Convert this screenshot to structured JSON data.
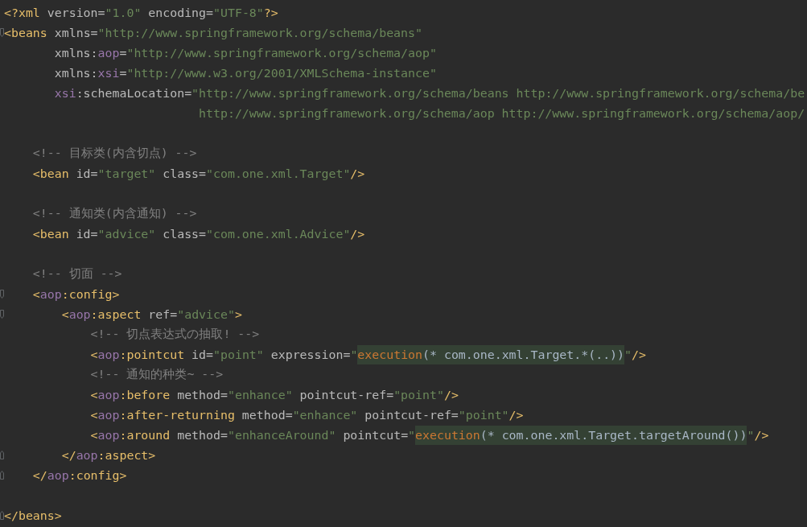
{
  "editor": {
    "lines": [
      {
        "tokens": [
          {
            "kind": "tag",
            "text": "<?xml "
          },
          {
            "kind": "attr",
            "text": "version="
          },
          {
            "kind": "value",
            "text": "\"1.0\" "
          },
          {
            "kind": "attr",
            "text": "encoding="
          },
          {
            "kind": "value",
            "text": "\"UTF-8\""
          },
          {
            "kind": "tag",
            "text": "?>"
          }
        ]
      },
      {
        "fold_start": true,
        "tokens": [
          {
            "kind": "tag",
            "text": "<beans "
          },
          {
            "kind": "attr",
            "text": "xmlns="
          },
          {
            "kind": "value",
            "text": "\"http://www.springframework.org/schema/beans\""
          }
        ]
      },
      {
        "tokens": [
          {
            "kind": "attr",
            "text": "       xmlns:"
          },
          {
            "kind": "ns",
            "text": "aop"
          },
          {
            "kind": "attr",
            "text": "="
          },
          {
            "kind": "value",
            "text": "\"http://www.springframework.org/schema/aop\""
          }
        ]
      },
      {
        "tokens": [
          {
            "kind": "attr",
            "text": "       xmlns:"
          },
          {
            "kind": "ns",
            "text": "xsi"
          },
          {
            "kind": "attr",
            "text": "="
          },
          {
            "kind": "value",
            "text": "\"http://www.w3.org/2001/XMLSchema-instance\""
          }
        ]
      },
      {
        "tokens": [
          {
            "kind": "ns",
            "text": "       xsi"
          },
          {
            "kind": "attr",
            "text": ":schemaLocation="
          },
          {
            "kind": "value",
            "text": "\"http://www.springframework.org/schema/beans http://www.springframework.org/schema/be"
          }
        ]
      },
      {
        "tokens": [
          {
            "kind": "value",
            "text": "                           http://www.springframework.org/schema/aop http://www.springframework.org/schema/aop/"
          }
        ]
      },
      {
        "space_above": true,
        "tokens": [
          {
            "kind": "comment",
            "text": "    <!-- 目标类(内含切点) -->"
          }
        ]
      },
      {
        "tokens": [
          {
            "kind": "tag",
            "text": "    <bean "
          },
          {
            "kind": "attr",
            "text": "id="
          },
          {
            "kind": "value",
            "text": "\"target\" "
          },
          {
            "kind": "attr",
            "text": "class="
          },
          {
            "kind": "value",
            "text": "\"com.one.xml.Target\""
          },
          {
            "kind": "tag",
            "text": "/>"
          }
        ]
      },
      {
        "space_above": true,
        "tokens": [
          {
            "kind": "comment",
            "text": "    <!-- 通知类(内含通知) -->"
          }
        ]
      },
      {
        "tokens": [
          {
            "kind": "tag",
            "text": "    <bean "
          },
          {
            "kind": "attr",
            "text": "id="
          },
          {
            "kind": "value",
            "text": "\"advice\" "
          },
          {
            "kind": "attr",
            "text": "class="
          },
          {
            "kind": "value",
            "text": "\"com.one.xml.Advice\""
          },
          {
            "kind": "tag",
            "text": "/>"
          }
        ]
      },
      {
        "space_above": true,
        "tokens": [
          {
            "kind": "comment",
            "text": "    <!-- 切面 -->"
          }
        ]
      },
      {
        "fold_start": true,
        "tokens": [
          {
            "kind": "tag",
            "text": "    <"
          },
          {
            "kind": "ns",
            "text": "aop"
          },
          {
            "kind": "tag",
            "text": ":config>"
          }
        ]
      },
      {
        "fold_start": true,
        "tokens": [
          {
            "kind": "tag",
            "text": "        <"
          },
          {
            "kind": "ns",
            "text": "aop"
          },
          {
            "kind": "tag",
            "text": ":aspect "
          },
          {
            "kind": "attr",
            "text": "ref="
          },
          {
            "kind": "value",
            "text": "\"advice\""
          },
          {
            "kind": "tag",
            "text": ">"
          }
        ]
      },
      {
        "tokens": [
          {
            "kind": "comment",
            "text": "            <!-- 切点表达式の抽取! -->"
          }
        ]
      },
      {
        "tokens": [
          {
            "kind": "tag",
            "text": "            <"
          },
          {
            "kind": "ns",
            "text": "aop"
          },
          {
            "kind": "tag",
            "text": ":pointcut "
          },
          {
            "kind": "attr",
            "text": "id="
          },
          {
            "kind": "value",
            "text": "\"point\" "
          },
          {
            "kind": "attr",
            "text": "expression="
          },
          {
            "kind": "value",
            "text": "\""
          },
          {
            "kind": "keyword",
            "text": "execution"
          },
          {
            "kind": "code",
            "text": "(* com.one.xml.Target.*(..))"
          },
          {
            "kind": "value",
            "text": "\""
          },
          {
            "kind": "tag",
            "text": "/>"
          }
        ]
      },
      {
        "tokens": [
          {
            "kind": "comment",
            "text": "            <!-- 通知的种类~ -->"
          }
        ]
      },
      {
        "tokens": [
          {
            "kind": "tag",
            "text": "            <"
          },
          {
            "kind": "ns",
            "text": "aop"
          },
          {
            "kind": "tag",
            "text": ":before "
          },
          {
            "kind": "attr",
            "text": "method="
          },
          {
            "kind": "value",
            "text": "\"enhance\" "
          },
          {
            "kind": "attr",
            "text": "pointcut-ref="
          },
          {
            "kind": "value",
            "text": "\"point\""
          },
          {
            "kind": "tag",
            "text": "/>"
          }
        ]
      },
      {
        "tokens": [
          {
            "kind": "tag",
            "text": "            <"
          },
          {
            "kind": "ns",
            "text": "aop"
          },
          {
            "kind": "tag",
            "text": ":after-returning "
          },
          {
            "kind": "attr",
            "text": "method="
          },
          {
            "kind": "value",
            "text": "\"enhance\" "
          },
          {
            "kind": "attr",
            "text": "pointcut-ref="
          },
          {
            "kind": "value",
            "text": "\"point\""
          },
          {
            "kind": "tag",
            "text": "/>"
          }
        ]
      },
      {
        "tokens": [
          {
            "kind": "tag",
            "text": "            <"
          },
          {
            "kind": "ns",
            "text": "aop"
          },
          {
            "kind": "tag",
            "text": ":around "
          },
          {
            "kind": "attr",
            "text": "method="
          },
          {
            "kind": "value",
            "text": "\"enhanceAround\" "
          },
          {
            "kind": "attr",
            "text": "pointcut="
          },
          {
            "kind": "value",
            "text": "\""
          },
          {
            "kind": "keyword",
            "text": "execution"
          },
          {
            "kind": "code",
            "text": "(* com.one.xml.Target.targetAround())"
          },
          {
            "kind": "value",
            "text": "\""
          },
          {
            "kind": "tag",
            "text": "/>"
          }
        ]
      },
      {
        "fold_end": true,
        "tokens": [
          {
            "kind": "tag",
            "text": "        </"
          },
          {
            "kind": "ns",
            "text": "aop"
          },
          {
            "kind": "tag",
            "text": ":aspect>"
          }
        ]
      },
      {
        "fold_end": true,
        "tokens": [
          {
            "kind": "tag",
            "text": "    </"
          },
          {
            "kind": "ns",
            "text": "aop"
          },
          {
            "kind": "tag",
            "text": ":config>"
          }
        ]
      },
      {
        "space_above": true,
        "fold_end": true,
        "tokens": [
          {
            "kind": "tag",
            "text": "</beans>"
          }
        ]
      }
    ]
  }
}
